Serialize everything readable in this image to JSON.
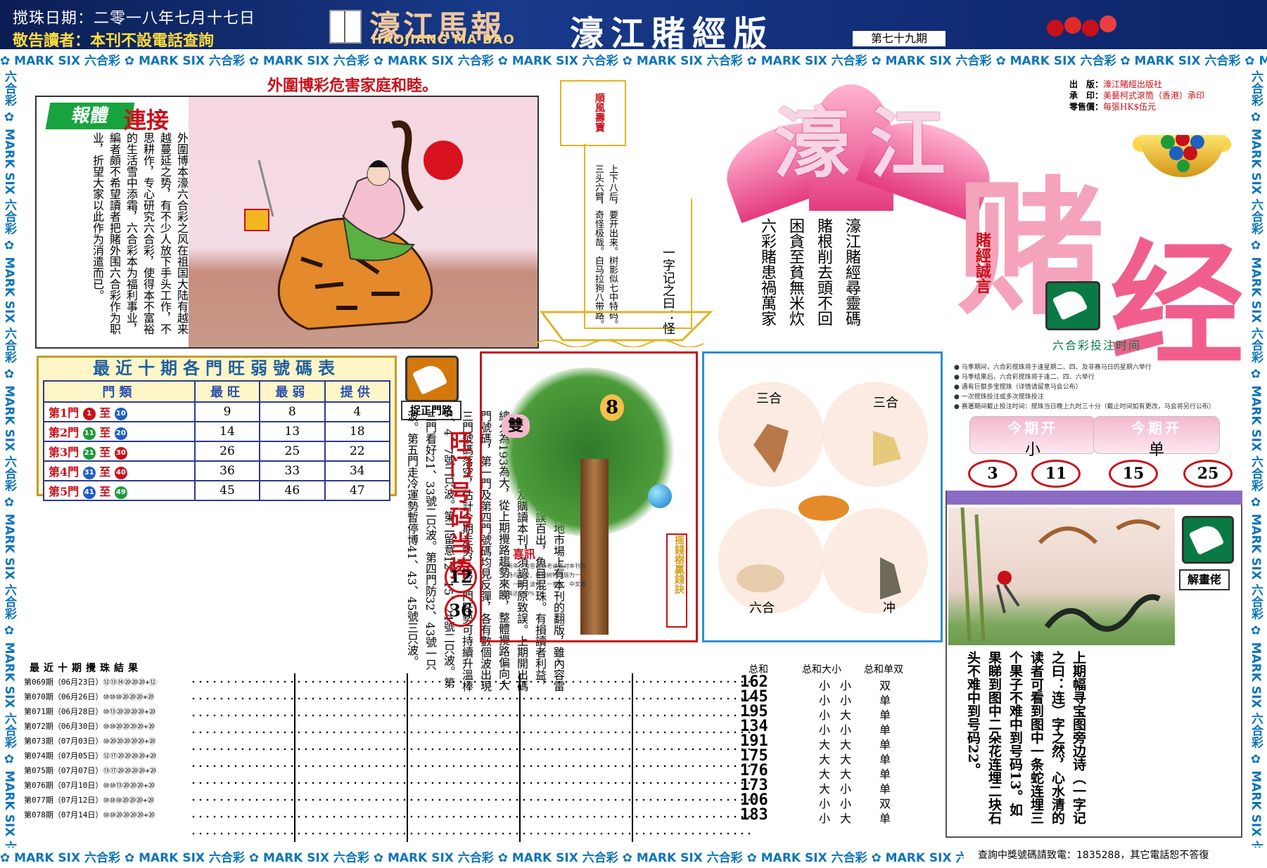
{
  "header": {
    "date": "搅珠日期：二零一八年七月十七日",
    "notice": "敬告讀者：本刊不設電話查詢",
    "brand_cn": "濠江馬報",
    "brand_en": "HAOJIANG MA BAO",
    "edition": "濠江賭經版",
    "issue": "第七十九期"
  },
  "border": {
    "text": "✿ MARK SIX 六合彩 ✿ MARK SIX 六合彩 ✿ MARK SIX 六合彩 ✿ MARK SIX 六合彩 ✿ MARK SIX 六合彩 ✿ MARK SIX 六合彩 ✿ MARK SIX 六合彩 ✿ MARK SIX 六合彩 ✿ MARK SIX 六合彩 ✿ MARK SIX 六合彩 ✿ MARK SIX",
    "side_text": "六合彩 ✿ MARK SIX 六合彩 ✿ MARK SIX 六合彩 ✿ MARK SIX 六合彩 ✿ MARK SIX 六合彩 ✿ MARK SIX 六合彩 ✿ MARK SIX 六合彩 ✿ MARK SIX"
  },
  "warning": "外圍博彩危害家庭和睦。",
  "link_box": {
    "tag1": "報體",
    "tag2": "連接",
    "body": "外圍博本濠六合彩之风在祖国大陆有越来越蔓延之势，有不少人放下手头工作，不思耕作，专心研究六合彩，使得本不富裕的生活雪中添霜，六合彩本为福利事业，編者頗不希望讀者把賭外围六合彩作为职业，折望大家以此作为消遣而已。"
  },
  "ship": {
    "flag": "順風壽寶",
    "poem_title": "一字记之曰：怪",
    "poem": "上下八后，要开出来。树影似七中特码。三头六臂，奇怪极哉。白马拉狗八带路。"
  },
  "logo": {
    "t1": "濠江",
    "t2": "赌",
    "t3": "经",
    "motto": "賭經誠言",
    "cols": [
      "六彩賭患禍萬家",
      "困貪至貧無米炊",
      "賭根削去頭不回",
      "濠江賭經尋靈碼"
    ]
  },
  "publisher": {
    "l1k": "出　版：",
    "l1v": "濠江賭經出版社",
    "l2k": "承　印：",
    "l2v": "美藝柯式滾筒（香港）承印",
    "l3k": "零售價：",
    "l3v": "每張HK$伍元"
  },
  "bet_time": "六合彩投注时间",
  "stats": {
    "title": "最近十期各門旺弱號碼表",
    "headers": [
      "門類",
      "最旺",
      "最弱",
      "提供"
    ],
    "rows": [
      {
        "gate": "第1門",
        "from": "1",
        "to": "10",
        "c1": "#c8101a",
        "c2": "#1e5fc0",
        "hot": "9",
        "cold": "8",
        "tip": "4"
      },
      {
        "gate": "第2門",
        "from": "11",
        "to": "20",
        "c1": "#1c9a3c",
        "c2": "#1e5fc0",
        "hot": "14",
        "cold": "13",
        "tip": "18"
      },
      {
        "gate": "第3門",
        "from": "21",
        "to": "30",
        "c1": "#1c9a3c",
        "c2": "#c8101a",
        "hot": "26",
        "cold": "25",
        "tip": "22"
      },
      {
        "gate": "第4門",
        "from": "31",
        "to": "40",
        "c1": "#1e5fc0",
        "c2": "#c8101a",
        "hot": "36",
        "cold": "33",
        "tip": "34"
      },
      {
        "gate": "第5門",
        "from": "41",
        "to": "49",
        "c1": "#1e5fc0",
        "c2": "#1c9a3c",
        "hot": "45",
        "cold": "46",
        "tip": "47"
      }
    ]
  },
  "gate_road": "捉正門路",
  "reader_note": "敬告讀者：近期發現內地市場上有本刊的翻版，雖內容雷同，但字迹模糊，錯誤百出，魚目混珠。有損讀者利益，本刊敬請讀者朋友購讀本刊，須認明原致誤。上期開出碼總分為193為大，從上期攪路趨勢來睇，整體攪路偏向大門號碼，第一門及第四門號碼均見反彈，各有數個波出現三門號碼落空，估計今期走勢，第一門旺勢可持續升溫棒3、4、7號二只波。第二留意12、15、24號二只波。第三門看好21、33號二只波。第四門防32、43號一只波。第五門走冷運勢暫停博41、43、45號三只波。",
  "hot_gate": {
    "title": "旺门号码当捧",
    "n1": "12",
    "n2": "36"
  },
  "tree": {
    "label_left": "雙",
    "label_num": "8",
    "xi": "喜訊",
    "xi_text": "迎新年！为答谢新老读者对本刊的支持与厚爱，摇钱树特改版为一肖、一尾、波色、一单双、中奖率更高达100%",
    "side": "摇錢樹贏錢訣"
  },
  "zodiac": {
    "tl": "三合",
    "tr": "三合",
    "bl": "六合",
    "br": "冲"
  },
  "rules": [
    "● 马季期间，六合彩搅珠将于逢星期二、四、及非赛马日的星期六举行",
    "● 马季结果后，六合彩搅珠将于逢二、四、六举行",
    "● 遇有巨额多宝搅珠（详情请留意马会公布）",
    "● 一次搅珠投注或多次搅珠投注",
    "● 赛署期间截止投注时间：搅珠当日晚上九时三十分（截止时间如有更改，马会将另行公布）"
  ],
  "today": {
    "k1": "今期开",
    "v1": "小",
    "k2": "今期开",
    "v2": "单",
    "nums": [
      "3",
      "11",
      "15",
      "25"
    ]
  },
  "puzzle": {
    "label": "解畫佬",
    "text": "上期幅寻宝图旁边诗（一字记之曰：连）字之然，心水清的读者可看到图中一条蛇连埋三个果子不难中到号码13。如果睇到图中二朵花连埋二块石头不难中到号码22。"
  },
  "results": {
    "header": "最近十期攪珠結果",
    "col_sum": "总和",
    "col_bs": "总和大小",
    "col_od": "总和单双",
    "rows": [
      {
        "id": "第069期（06月23日）",
        "nums": "⑫⑬⑭⑳⑳⑳+⑫",
        "sum": "162",
        "bs": "小",
        "bs2": "小",
        "od": "双"
      },
      {
        "id": "第070期（06月26日）",
        "nums": "⑩⑩⑩⑳⑳⑳+⑳",
        "sum": "145",
        "bs": "小",
        "bs2": "小",
        "od": "单"
      },
      {
        "id": "第071期（06月28日）",
        "nums": "⑩⑬⑳⑳⑳⑳+⑳",
        "sum": "195",
        "bs": "小",
        "bs2": "大",
        "od": "单"
      },
      {
        "id": "第072期（06月30日）",
        "nums": "⑩⑩⑳⑳⑳⑳+⑳",
        "sum": "134",
        "bs": "小",
        "bs2": "小",
        "od": "单"
      },
      {
        "id": "第073期（07月03日）",
        "nums": "⑩⑳⑳⑳⑳⑳+⑳",
        "sum": "191",
        "bs": "大",
        "bs2": "大",
        "od": "单"
      },
      {
        "id": "第074期（07月05日）",
        "nums": "⑫⑰⑳⑳⑳⑳+⑳",
        "sum": "175",
        "bs": "大",
        "bs2": "大",
        "od": "单"
      },
      {
        "id": "第075期（07月07日）",
        "nums": "⑬⑰⑳⑳⑳⑳+⑳",
        "sum": "176",
        "bs": "大",
        "bs2": "大",
        "od": "单"
      },
      {
        "id": "第076期（07月10日）",
        "nums": "⑩⑩⑬⑳⑳⑳+⑳",
        "sum": "173",
        "bs": "大",
        "bs2": "小",
        "od": "单"
      },
      {
        "id": "第077期（07月12日）",
        "nums": "⑩⑩⑩⑳⑳⑳+⑳",
        "sum": "106",
        "bs": "小",
        "bs2": "小",
        "od": "双"
      },
      {
        "id": "第078期（07月14日）",
        "nums": "⑩⑩⑳⑳⑳⑳+⑳",
        "sum": "183",
        "bs": "小",
        "bs2": "大",
        "od": "单"
      }
    ]
  },
  "hotline": "查詢中獎號碼請致電：1835288，其它電話恕不答復"
}
